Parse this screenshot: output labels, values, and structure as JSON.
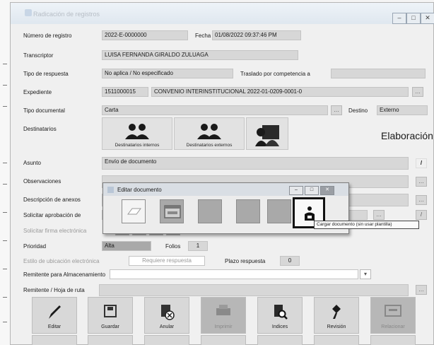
{
  "window": {
    "title": "Radicación de registros",
    "buttons": {
      "minimize": "–",
      "maximize": "□",
      "close": "✕"
    }
  },
  "form": {
    "numero_registro": {
      "label": "Número de registro",
      "value": "2022-E-0000000"
    },
    "fecha": {
      "label": "Fecha",
      "value": "01/08/2022 09:37:46 PM"
    },
    "transcriptor": {
      "label": "Transcriptor",
      "value": "LUISA FERNANDA GIRALDO ZULUAGA"
    },
    "tipo_respuesta": {
      "label": "Tipo de respuesta",
      "value": "No aplica / No especificado"
    },
    "traslado": {
      "label": "Traslado por competencia a",
      "value": ""
    },
    "expediente": {
      "label": "Expediente",
      "code": "1511000015",
      "value": "CONVENIO INTERINSTITUCIONAL 2022-01-0209-0001-0"
    },
    "tipo_documental": {
      "label": "Tipo documental",
      "value": "Carta"
    },
    "destino": {
      "label": "Destino",
      "value": "Externo"
    },
    "destinatarios": {
      "label": "Destinatarios",
      "internos": "Destinatarios internos",
      "externos": "Destinatarios externos"
    },
    "elaboracion": "Elaboración",
    "asunto": {
      "label": "Asunto",
      "value": "Envío de documento"
    },
    "observaciones": {
      "label": "Observaciones",
      "value": ""
    },
    "descripcion_anexos": {
      "label": "Descripción de anexos",
      "value": ""
    },
    "solicitar_aprobacion": {
      "label": "Solicitar aprobación de",
      "value": ""
    },
    "solicitar_firma": {
      "label": "Solicitar firma electrónica",
      "value": ""
    },
    "prioridad": {
      "label": "Prioridad",
      "value": "Alta"
    },
    "folios": {
      "label": "Folios",
      "value": "1"
    },
    "estilo_ubicacion": {
      "label": "Estilo de ubicación electrónica",
      "value": "Requiere respuesta"
    },
    "plazo_respuesta": {
      "label": "Plazo respuesta",
      "value": "0"
    },
    "remitente_archivo": {
      "label": "Remitente para Almacenamiento",
      "value": ""
    },
    "remitente_hoja": {
      "label": "Remitente / Hoja de ruta",
      "value": ""
    }
  },
  "dialog": {
    "title": "Editar documento",
    "buttons": {
      "minimize": "–",
      "maximize": "□",
      "close": "✕"
    },
    "tooltip": "Cargar documento (sin usar plantilla)"
  },
  "toolbar": {
    "tools": [
      "Editar",
      "Guardar",
      "Anular",
      "Imprimir",
      "Indices",
      "Revisión",
      "Relacionar"
    ]
  },
  "colors": {
    "accent_border": "#111111",
    "field_gray": "#d7d7d7"
  }
}
